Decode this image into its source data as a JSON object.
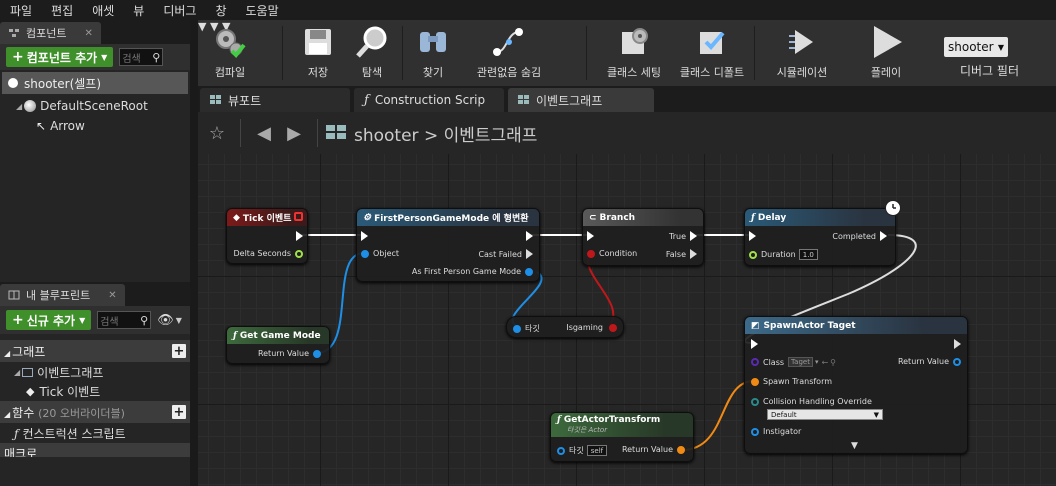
{
  "menu": [
    "파일",
    "편집",
    "애셋",
    "뷰",
    "디버그",
    "창",
    "도움말"
  ],
  "components_panel": {
    "title": "컴포넌트",
    "add_button": "컴포넌트 추가",
    "search_placeholder": "검색",
    "self_row": "shooter(셀프)",
    "tree": [
      "DefaultSceneRoot",
      "Arrow"
    ]
  },
  "blueprint_panel": {
    "title": "내 블루프린트",
    "new_button": "신규 추가",
    "search_placeholder": "검색",
    "sections": {
      "graph": "그래프",
      "graph_items": [
        "이벤트그래프",
        "Tick 이벤트"
      ],
      "functions": "함수",
      "functions_note": "(20 오버라이더블)",
      "function_items": [
        "컨스트럭션 스크립트"
      ],
      "macros": "매크로"
    }
  },
  "toolbar": {
    "compile": "컴파일",
    "save": "저장",
    "browse": "탐색",
    "find": "찾기",
    "hide_unrelated": "관련없음 숨김",
    "class_settings": "클래스 세팅",
    "class_defaults": "클래스 디폴트",
    "simulation": "시뮬레이션",
    "play": "플레이",
    "debug_object": "shooter",
    "debug_filter": "디버그 필터"
  },
  "graph_tabs": [
    "뷰포트",
    "Construction Scrip",
    "이벤트그래프"
  ],
  "breadcrumb": {
    "root": "shooter",
    "separator": ">",
    "current": "이벤트그래프"
  },
  "nodes": {
    "tick": {
      "title": "Tick 이벤트",
      "pin_delta": "Delta Seconds"
    },
    "cast": {
      "title": "FirstPersonGameMode 에 형변환",
      "pin_object": "Object",
      "pin_cast_failed": "Cast Failed",
      "pin_as": "As First Person Game Mode"
    },
    "branch": {
      "title": "Branch",
      "pin_true": "True",
      "pin_condition": "Condition",
      "pin_false": "False"
    },
    "delay": {
      "title": "Delay",
      "pin_completed": "Completed",
      "pin_duration": "Duration",
      "duration_value": "1.0"
    },
    "get_game_mode": {
      "title": "Get Game Mode",
      "pin_return": "Return Value"
    },
    "isgaming": {
      "pin_target": "타깃",
      "pin_out": "Isgaming"
    },
    "spawn": {
      "title": "SpawnActor Taget",
      "pin_class": "Class",
      "class_value": "Taget",
      "pin_return": "Return Value",
      "pin_transform": "Spawn Transform",
      "pin_collision": "Collision Handling Override",
      "collision_value": "Default",
      "pin_instigator": "Instigator"
    },
    "get_transform": {
      "title": "GetActorTransform",
      "subtitle": "타깃은 Actor",
      "pin_target": "타깃",
      "target_value": "self",
      "pin_return": "Return Value"
    }
  },
  "colors": {
    "exec": "#ffffff",
    "float": "#a2e04a",
    "object": "#1e8fe6",
    "bool": "#c0181a",
    "transform": "#f08a14",
    "class": "#5a2ab3",
    "button_green": "#3f8f2a"
  }
}
